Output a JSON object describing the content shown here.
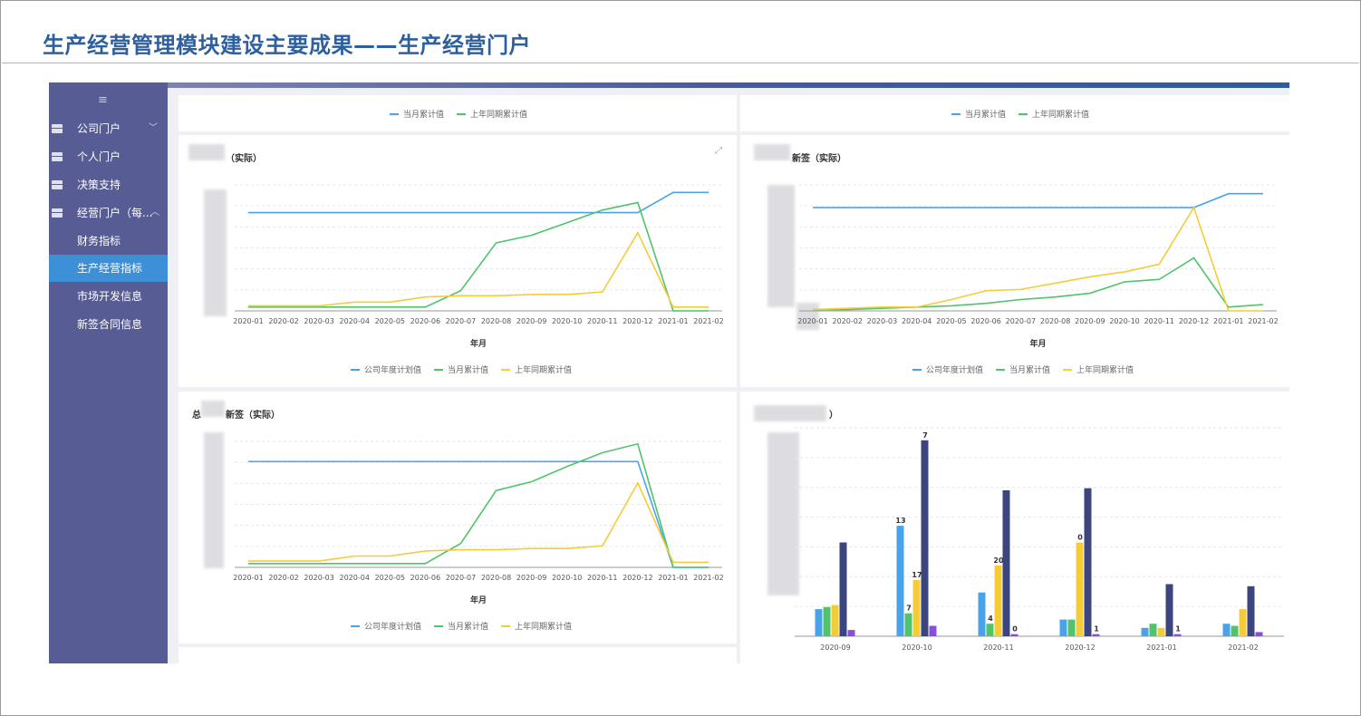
{
  "slide": {
    "title": "生产经营管理模块建设主要成果——生产经营门户"
  },
  "colors": {
    "blue": "#4aa3e8",
    "green": "#4fc46a",
    "yellow": "#f4cc3a",
    "navy": "#3b4580",
    "purple": "#8a4fd8",
    "sidebar": "#575c94",
    "active": "#3d8fd6"
  },
  "sidebar": {
    "menu_icon": "≡",
    "items": [
      {
        "label": "公司门户",
        "icon": "grid-icon",
        "chevron": "﹀"
      },
      {
        "label": "个人门户",
        "icon": "grid-icon"
      },
      {
        "label": "决策支持",
        "icon": "grid-icon"
      },
      {
        "label": "经营门户（每...",
        "icon": "grid-icon",
        "chevron": "︿"
      }
    ],
    "sub_items": [
      {
        "label": "财务指标"
      },
      {
        "label": "生产经营指标"
      },
      {
        "label": "市场开发信息"
      },
      {
        "label": "新签合同信息"
      }
    ]
  },
  "top_panels": {
    "legend": [
      "当月累计值",
      "上年同期累计值"
    ]
  },
  "line_panels": [
    {
      "title": "（实际）",
      "xlabel": "年月",
      "legend": [
        "公司年度计划值",
        "当月累计值",
        "上年同期累计值"
      ]
    },
    {
      "title": "新签（实际）",
      "xlabel": "年月",
      "legend": [
        "公司年度计划值",
        "当月累计值",
        "上年同期累计值"
      ]
    },
    {
      "title": "新签（实际）",
      "title_prefix": "总",
      "xlabel": "年月",
      "legend": [
        "公司年度计划值",
        "当月累计值",
        "上年同期累计值"
      ]
    }
  ],
  "bar_panel": {
    "title": "）"
  },
  "chart_data": [
    {
      "type": "line",
      "title": "（实际）",
      "xlabel": "年月",
      "categories": [
        "2020-01",
        "2020-02",
        "2020-03",
        "2020-04",
        "2020-05",
        "2020-06",
        "2020-07",
        "2020-08",
        "2020-09",
        "2020-10",
        "2020-11",
        "2020-12",
        "2021-01",
        "2021-02"
      ],
      "ylim": [
        0,
        100
      ],
      "series": [
        {
          "name": "公司年度计划值",
          "color": "#4aa3e8",
          "values": [
            78,
            78,
            78,
            78,
            78,
            78,
            78,
            78,
            78,
            78,
            78,
            78,
            94,
            94
          ]
        },
        {
          "name": "当月累计值",
          "color": "#4fc46a",
          "values": [
            3,
            3,
            3,
            3,
            3,
            3,
            16,
            54,
            60,
            70,
            80,
            86,
            0,
            0
          ]
        },
        {
          "name": "上年同期累计值",
          "color": "#f4cc3a",
          "values": [
            4,
            4,
            4,
            7,
            7,
            11,
            12,
            12,
            13,
            13,
            15,
            62,
            3,
            3
          ]
        }
      ]
    },
    {
      "type": "line",
      "title": "新签（实际）",
      "xlabel": "年月",
      "categories": [
        "2020-01",
        "2020-02",
        "2020-03",
        "2020-04",
        "2020-05",
        "2020-06",
        "2020-07",
        "2020-08",
        "2020-09",
        "2020-10",
        "2020-11",
        "2020-12",
        "2021-01",
        "2021-02"
      ],
      "ylim": [
        0,
        100
      ],
      "series": [
        {
          "name": "公司年度计划值",
          "color": "#4aa3e8",
          "values": [
            82,
            82,
            82,
            82,
            82,
            82,
            82,
            82,
            82,
            82,
            82,
            82,
            93,
            93
          ]
        },
        {
          "name": "当月累计值",
          "color": "#4fc46a",
          "values": [
            1,
            1,
            2,
            3,
            4,
            6,
            9,
            11,
            14,
            23,
            25,
            42,
            3,
            5
          ]
        },
        {
          "name": "上年同期累计值",
          "color": "#f4cc3a",
          "values": [
            1,
            2,
            3,
            3,
            9,
            16,
            17,
            22,
            27,
            31,
            37,
            82,
            0,
            0
          ]
        }
      ]
    },
    {
      "type": "line",
      "title": "总新签（实际）",
      "xlabel": "年月",
      "categories": [
        "2020-01",
        "2020-02",
        "2020-03",
        "2020-04",
        "2020-05",
        "2020-06",
        "2020-07",
        "2020-08",
        "2020-09",
        "2020-10",
        "2020-11",
        "2020-12",
        "2021-01",
        "2021-02"
      ],
      "ylim": [
        0,
        100
      ],
      "series": [
        {
          "name": "公司年度计划值",
          "color": "#4aa3e8",
          "values": [
            84,
            84,
            84,
            84,
            84,
            84,
            84,
            84,
            84,
            84,
            84,
            84,
            0,
            0
          ]
        },
        {
          "name": "当月累计值",
          "color": "#4fc46a",
          "values": [
            3,
            3,
            3,
            3,
            3,
            3,
            19,
            61,
            68,
            80,
            91,
            98,
            0,
            0
          ]
        },
        {
          "name": "上年同期累计值",
          "color": "#f4cc3a",
          "values": [
            5,
            5,
            5,
            9,
            9,
            13,
            14,
            14,
            15,
            15,
            17,
            67,
            4,
            4
          ]
        }
      ]
    },
    {
      "type": "bar",
      "categories": [
        "2020-09",
        "2020-10",
        "2020-11",
        "2020-12",
        "2021-01",
        "2021-02"
      ],
      "ylim": [
        0,
        100
      ],
      "series": [
        {
          "color": "#4aa3e8",
          "values": [
            13,
            53,
            21,
            8,
            4,
            6
          ]
        },
        {
          "color": "#4fc46a",
          "values": [
            14,
            11,
            6,
            8,
            6,
            5
          ]
        },
        {
          "color": "#f4cc3a",
          "values": [
            15,
            27,
            34,
            45,
            4,
            13
          ]
        },
        {
          "color": "#3b4580",
          "values": [
            45,
            94,
            70,
            71,
            25,
            24
          ]
        },
        {
          "color": "#8a4fd8",
          "values": [
            3,
            5,
            1,
            1,
            1,
            2
          ]
        }
      ],
      "data_labels": [
        {
          "category": "2020-10",
          "series": 0,
          "text": "13"
        },
        {
          "category": "2020-10",
          "series": 1,
          "text": "7"
        },
        {
          "category": "2020-10",
          "series": 2,
          "text": "17"
        },
        {
          "category": "2020-10",
          "series": 3,
          "text": "7"
        },
        {
          "category": "2020-11",
          "series": 1,
          "text": "4"
        },
        {
          "category": "2020-11",
          "series": 2,
          "text": "20"
        },
        {
          "category": "2020-11",
          "series": 4,
          "text": "0"
        },
        {
          "category": "2020-12",
          "series": 2,
          "text": "0"
        },
        {
          "category": "2020-12",
          "series": 4,
          "text": "1"
        },
        {
          "category": "2021-01",
          "series": 4,
          "text": "1"
        }
      ]
    }
  ]
}
